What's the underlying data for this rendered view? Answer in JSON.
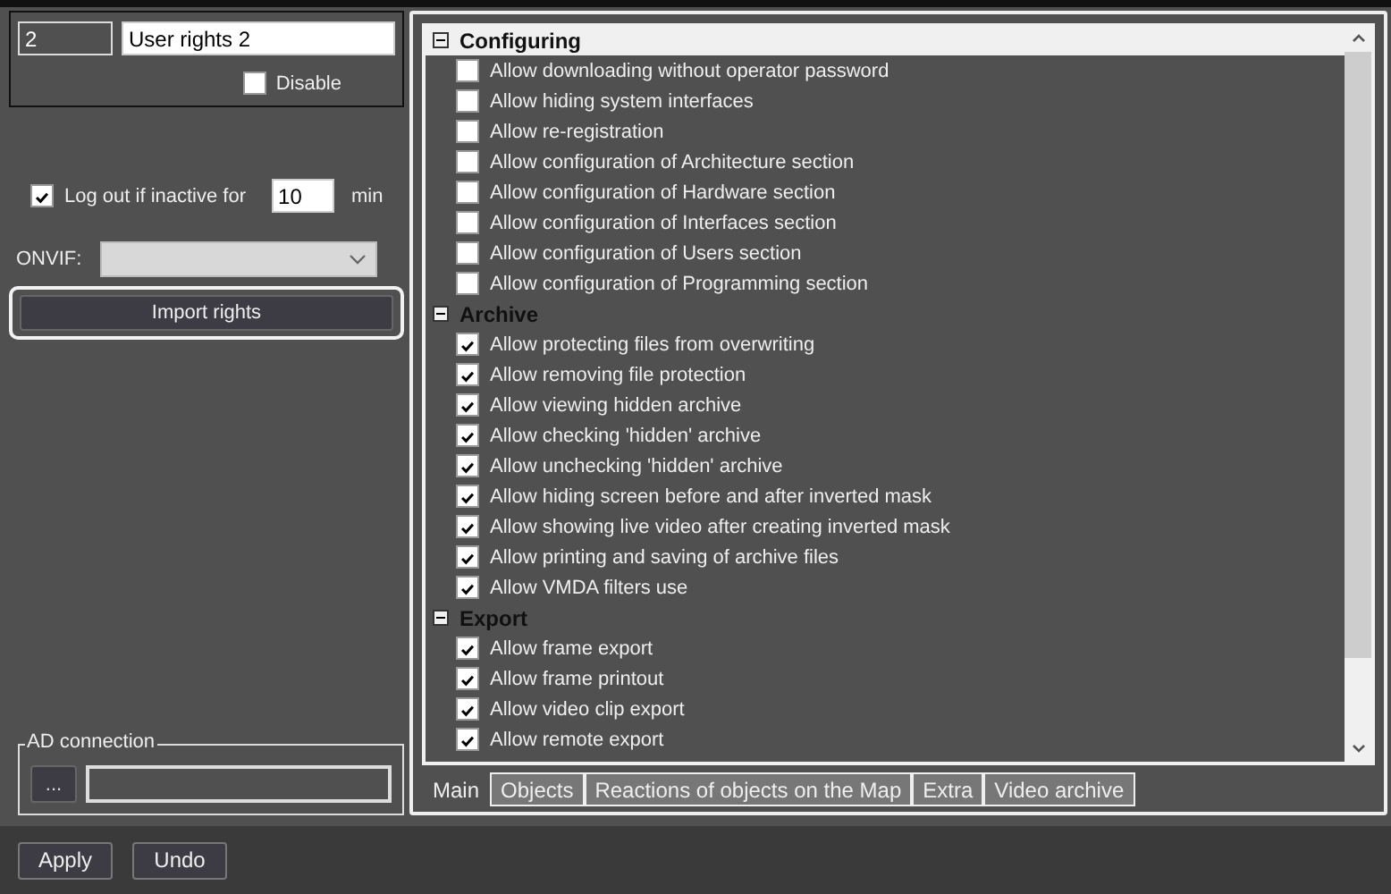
{
  "rights": {
    "id": "2",
    "name": "User rights 2",
    "disable": {
      "label": "Disable",
      "checked": false
    }
  },
  "logout": {
    "label": "Log out if inactive for",
    "checked": true,
    "value": "10",
    "unit": "min"
  },
  "onvif": {
    "label": "ONVIF:"
  },
  "import_button": "Import rights",
  "ad_connection": {
    "title": "AD connection",
    "browse": "..."
  },
  "groups": [
    {
      "title": "Configuring",
      "expanded": true,
      "selected": true,
      "items": [
        {
          "label": "Allow downloading without operator password",
          "checked": false
        },
        {
          "label": "Allow hiding system interfaces",
          "checked": false
        },
        {
          "label": "Allow re-registration",
          "checked": false
        },
        {
          "label": "Allow configuration of Architecture section",
          "checked": false
        },
        {
          "label": "Allow configuration of Hardware section",
          "checked": false
        },
        {
          "label": "Allow configuration of Interfaces section",
          "checked": false
        },
        {
          "label": "Allow configuration of Users section",
          "checked": false
        },
        {
          "label": "Allow configuration of Programming section",
          "checked": false
        }
      ]
    },
    {
      "title": "Archive",
      "expanded": true,
      "selected": false,
      "items": [
        {
          "label": "Allow protecting files from overwriting",
          "checked": true
        },
        {
          "label": "Allow removing file protection",
          "checked": true
        },
        {
          "label": "Allow viewing hidden archive",
          "checked": true
        },
        {
          "label": "Allow checking 'hidden' archive",
          "checked": true
        },
        {
          "label": "Allow unchecking 'hidden' archive",
          "checked": true
        },
        {
          "label": "Allow hiding screen before and after inverted mask",
          "checked": true
        },
        {
          "label": "Allow showing live video after creating inverted mask",
          "checked": true
        },
        {
          "label": "Allow printing and saving of archive files",
          "checked": true
        },
        {
          "label": "Allow VMDA filters use",
          "checked": true
        }
      ]
    },
    {
      "title": "Export",
      "expanded": true,
      "selected": false,
      "items": [
        {
          "label": "Allow frame export",
          "checked": true
        },
        {
          "label": "Allow frame printout",
          "checked": true
        },
        {
          "label": "Allow video clip export",
          "checked": true
        },
        {
          "label": "Allow remote export",
          "checked": true
        }
      ]
    }
  ],
  "tabs": [
    {
      "label": "Main",
      "selected": true
    },
    {
      "label": "Objects",
      "selected": false
    },
    {
      "label": "Reactions of objects on the Map",
      "selected": false
    },
    {
      "label": "Extra",
      "selected": false
    },
    {
      "label": "Video archive",
      "selected": false
    }
  ],
  "buttons": [
    "Apply",
    "Undo"
  ]
}
